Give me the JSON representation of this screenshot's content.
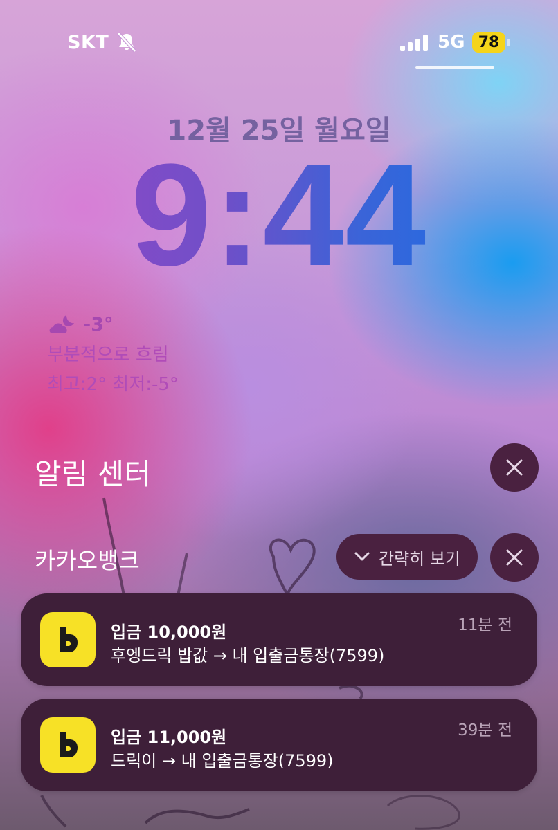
{
  "status_bar": {
    "carrier": "SKT",
    "network": "5G",
    "battery": "78",
    "icons": [
      "bell-slash-icon",
      "signal-bars-icon",
      "battery-icon"
    ]
  },
  "lock_screen": {
    "date": "12월 25일 월요일",
    "time": "9:44"
  },
  "weather": {
    "icon": "partly-cloudy-night-icon",
    "temperature": "-3°",
    "condition": "부분적으로 흐림",
    "high_low": "최고:2° 최저:-5°"
  },
  "notification_center": {
    "title": "알림 센터",
    "group": {
      "app_name": "카카오뱅크",
      "collapse_label": "간략히 보기",
      "notifications": [
        {
          "title": "입금 10,000원",
          "body": "후엥드릭 밥값 → 내 입출금통장(7599)",
          "time": "11분 전"
        },
        {
          "title": "입금 11,000원",
          "body": "드릭이 → 내 입출금통장(7599)",
          "time": "39분 전"
        }
      ]
    }
  },
  "colors": {
    "panel": "#4a2140",
    "notification_bg": "#3e1f39",
    "app_icon_yellow": "#f7e126",
    "battery_yellow": "#f5d41a"
  }
}
